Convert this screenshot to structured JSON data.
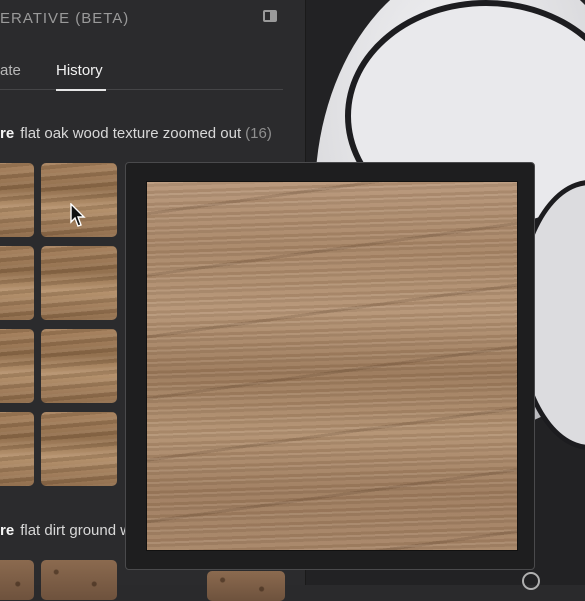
{
  "panel": {
    "title": "ERATIVE (BETA)",
    "tabs": [
      {
        "label": "ate",
        "active": false
      },
      {
        "label": "History",
        "active": true
      }
    ]
  },
  "history": [
    {
      "keyword": "re",
      "prompt": "flat oak wood texture zoomed out",
      "count": "(16)"
    },
    {
      "keyword": "re",
      "prompt": "flat dirt ground w",
      "count": ""
    }
  ],
  "preview": {
    "description": "oak wood texture preview"
  },
  "icons": [
    "panel-toggle-icon",
    "cursor-icon",
    "info-icon"
  ],
  "colors": {
    "panel_bg": "#2b2b2d",
    "accent_tab": "#f1f1f1"
  }
}
